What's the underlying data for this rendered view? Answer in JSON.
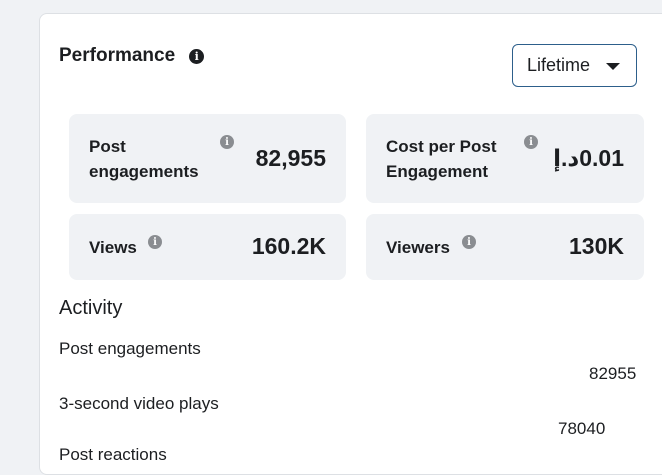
{
  "performance": {
    "title": "Performance",
    "info_icon": "info-icon",
    "range_select": "Lifetime"
  },
  "metrics": [
    {
      "label": "Post engagements",
      "value": "82,955"
    },
    {
      "label": "Cost per Post Engagement",
      "value": "0.01د.إ"
    },
    {
      "label": "Views",
      "value": "160.2K"
    },
    {
      "label": "Viewers",
      "value": "130K"
    }
  ],
  "activity": {
    "title": "Activity",
    "rows": [
      {
        "label": "Post engagements",
        "value": "82955"
      },
      {
        "label": "3-second video plays",
        "value": "78040"
      },
      {
        "label": "Post reactions",
        "value": ""
      }
    ]
  }
}
